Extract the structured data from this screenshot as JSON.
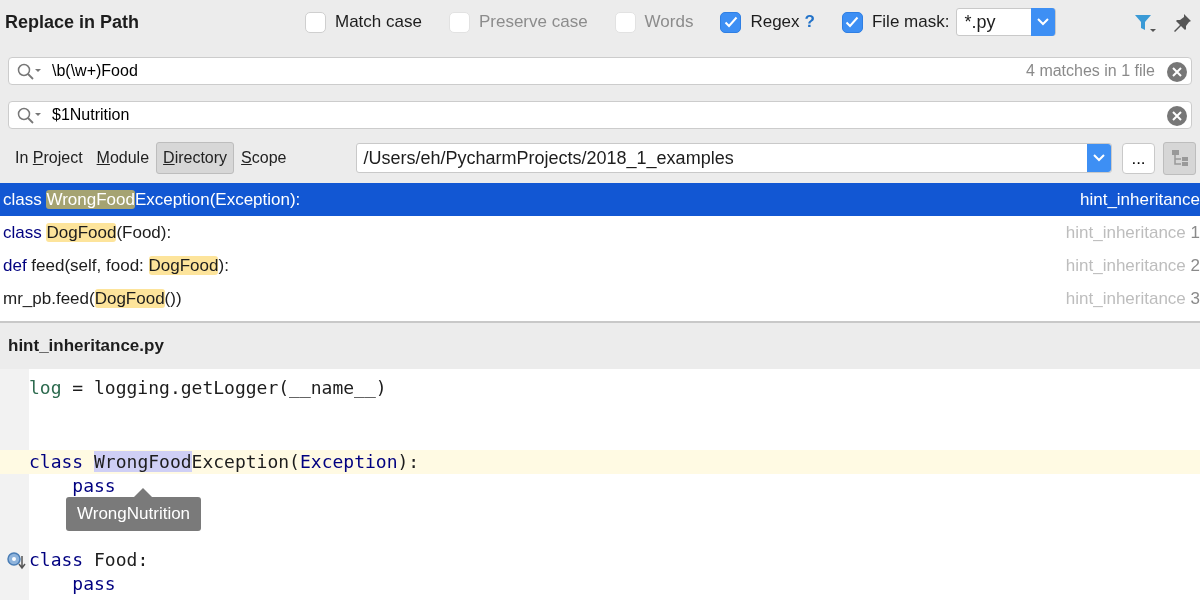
{
  "dialog": {
    "title": "Replace in Path",
    "options": [
      {
        "label": "Match case",
        "checked": false,
        "disabled": false
      },
      {
        "label": "Preserve case",
        "checked": false,
        "disabled": true
      },
      {
        "label": "Words",
        "checked": false,
        "disabled": true
      },
      {
        "label": "Regex",
        "checked": true,
        "disabled": false,
        "help": "?"
      }
    ],
    "file_mask": {
      "label": "File mask:",
      "checked": true,
      "value": "*.py"
    },
    "search": {
      "value": "\\b(\\w+)Food",
      "count": "4 matches in 1 file"
    },
    "replace": {
      "value": "$1Nutrition"
    },
    "scope_tabs": [
      {
        "before": "In ",
        "mnemonic": "P",
        "after": "roject",
        "selected": false
      },
      {
        "mnemonic": "M",
        "after": "odule",
        "selected": false
      },
      {
        "mnemonic": "D",
        "after": "irectory",
        "selected": true
      },
      {
        "mnemonic": "S",
        "after": "cope",
        "selected": false
      }
    ],
    "directory": {
      "value": "/Users/eh/PycharmProjects/2018_1_examples",
      "browse": "..."
    },
    "results": [
      {
        "selected": true,
        "location": "hint_inheritance",
        "tokens": [
          {
            "text": "class ",
            "kind": "keyword"
          },
          {
            "text": "WrongFood",
            "kind": "plain",
            "match": true
          },
          {
            "text": "Exception(Exception):",
            "kind": "plain"
          }
        ]
      },
      {
        "selected": false,
        "location": "hint_inheritance",
        "line": "1",
        "tokens": [
          {
            "text": "class ",
            "kind": "keyword"
          },
          {
            "text": "DogFood",
            "kind": "plain",
            "match": true
          },
          {
            "text": "(Food):",
            "kind": "plain"
          }
        ]
      },
      {
        "selected": false,
        "location": "hint_inheritance",
        "line": "2",
        "tokens": [
          {
            "text": "def ",
            "kind": "keyword"
          },
          {
            "text": "feed(self, food: ",
            "kind": "plain"
          },
          {
            "text": "DogFood",
            "kind": "plain",
            "match": true
          },
          {
            "text": "):",
            "kind": "plain"
          }
        ]
      },
      {
        "selected": false,
        "location": "hint_inheritance",
        "line": "3",
        "tokens": [
          {
            "text": "mr_pb.feed(",
            "kind": "plain"
          },
          {
            "text": "DogFood",
            "kind": "plain",
            "match": true
          },
          {
            "text": "())",
            "kind": "plain"
          }
        ]
      }
    ],
    "preview": {
      "file": "hint_inheritance.py",
      "lines": [
        {
          "current": false,
          "tokens": [
            {
              "text": "log",
              "kind": "variable"
            },
            {
              "text": " = logging.getLogger(__name__)",
              "kind": "plain"
            }
          ]
        },
        {
          "current": false
        },
        {
          "current": false
        },
        {
          "current": true,
          "tokens": [
            {
              "text": "class ",
              "kind": "keyword"
            },
            {
              "text": "WrongFood",
              "kind": "plain",
              "match": true
            },
            {
              "text": "Exception(",
              "kind": "plain"
            },
            {
              "text": "Exception",
              "kind": "builtin"
            },
            {
              "text": "):",
              "kind": "plain"
            }
          ]
        },
        {
          "current": false,
          "tokens": [
            {
              "text": "    pass",
              "kind": "keyword"
            }
          ]
        },
        {
          "current": false
        },
        {
          "current": false
        },
        {
          "current": false,
          "gutter_icon": true,
          "tokens": [
            {
              "text": "class ",
              "kind": "keyword"
            },
            {
              "text": "Food:",
              "kind": "plain"
            }
          ]
        },
        {
          "current": false,
          "tokens": [
            {
              "text": "    pass",
              "kind": "keyword"
            }
          ]
        }
      ],
      "tooltip": "WrongNutrition"
    }
  }
}
